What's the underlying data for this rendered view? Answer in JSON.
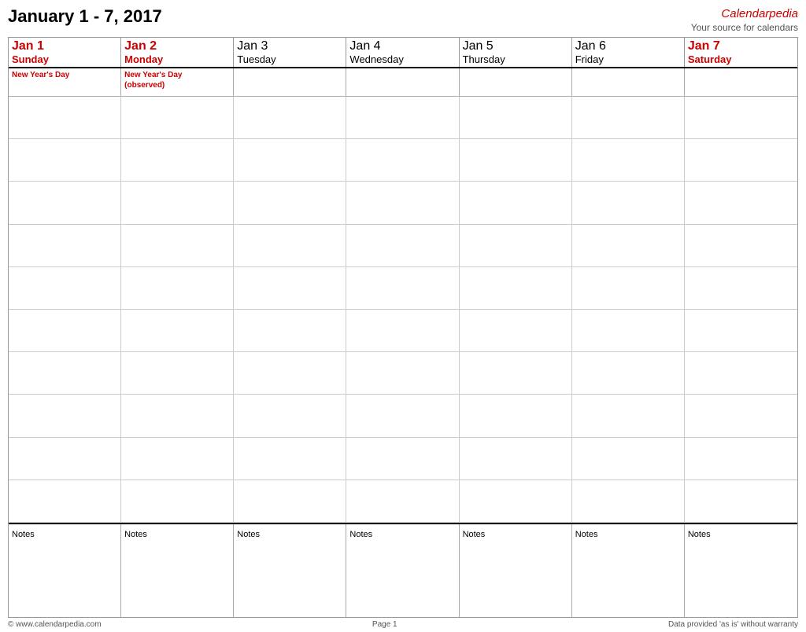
{
  "header": {
    "title": "January 1 - 7, 2017",
    "brand_name": "Calendar",
    "brand_italic": "pedia",
    "brand_tagline": "Your source for calendars"
  },
  "days": [
    {
      "num": "Jan 1",
      "name": "Sunday",
      "red": true,
      "holiday": "New Year's Day"
    },
    {
      "num": "Jan 2",
      "name": "Monday",
      "red": true,
      "holiday": "New Year's Day\n(observed)"
    },
    {
      "num": "Jan 3",
      "name": "Tuesday",
      "red": false,
      "holiday": ""
    },
    {
      "num": "Jan 4",
      "name": "Wednesday",
      "red": false,
      "holiday": ""
    },
    {
      "num": "Jan 5",
      "name": "Thursday",
      "red": false,
      "holiday": ""
    },
    {
      "num": "Jan 6",
      "name": "Friday",
      "red": false,
      "holiday": ""
    },
    {
      "num": "Jan 7",
      "name": "Saturday",
      "red": true,
      "holiday": ""
    }
  ],
  "notes_label": "Notes",
  "footer": {
    "left": "© www.calendarpedia.com",
    "center": "Page 1",
    "right": "Data provided 'as is' without warranty"
  }
}
